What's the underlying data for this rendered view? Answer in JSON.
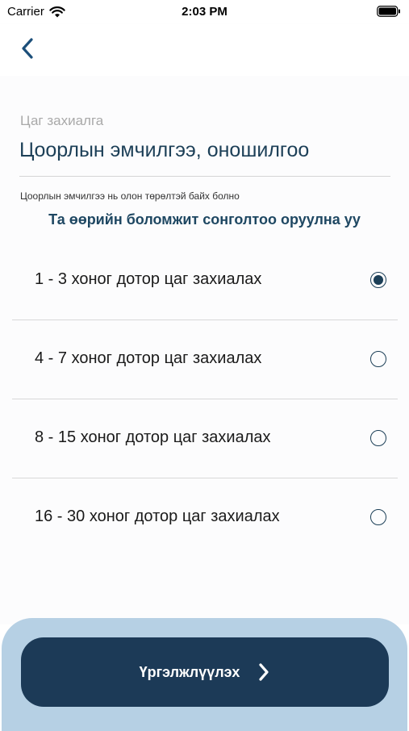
{
  "status_bar": {
    "carrier": "Carrier",
    "time": "2:03 PM"
  },
  "nav": {
    "back_icon": "chevron-left-icon"
  },
  "form": {
    "label": "Цаг захиалга",
    "value": "Цоорлын эмчилгээ, оношилгоо",
    "hint": "Цоорлын эмчилгээ нь олон төрөлтэй байх болно",
    "instruction": "Та өөрийн боломжит сонголтоо оруулна уу"
  },
  "options": [
    {
      "label": "1 - 3 хоног дотор цаг захиалах",
      "selected": true
    },
    {
      "label": "4 - 7 хоног дотор цаг захиалах",
      "selected": false
    },
    {
      "label": "8 - 15 хоног дотор цаг захиалах",
      "selected": false
    },
    {
      "label": "16 - 30 хоног дотор цаг захиалах",
      "selected": false
    }
  ],
  "continue_button": {
    "label": "Үргэлжлүүлэх",
    "icon": "chevron-right-icon"
  },
  "colors": {
    "primary": "#1c3a57",
    "panel": "#b6d0e4",
    "muted_label": "#a9a9a9"
  }
}
